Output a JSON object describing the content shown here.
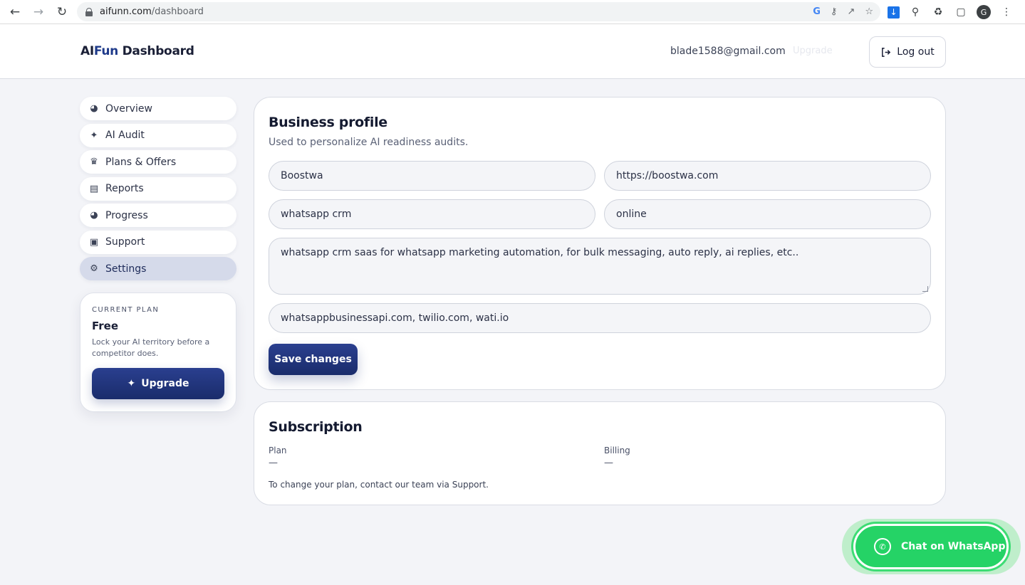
{
  "browser": {
    "url_host": "aifunn.com",
    "url_path": "/dashboard",
    "profile_initial": "G"
  },
  "header": {
    "brand_prefix": "AI",
    "brand_accent": "Fun",
    "brand_suffix": " Dashboard",
    "email": "blade1588@gmail.com",
    "ghost_upgrade": "Upgrade",
    "logout_label": "Log out"
  },
  "sidebar": {
    "items": [
      {
        "label": "Overview",
        "icon": "gauge-icon"
      },
      {
        "label": "AI Audit",
        "icon": "sparkles-icon"
      },
      {
        "label": "Plans & Offers",
        "icon": "crown-icon"
      },
      {
        "label": "Reports",
        "icon": "document-icon"
      },
      {
        "label": "Progress",
        "icon": "gauge-icon"
      },
      {
        "label": "Support",
        "icon": "chat-icon"
      },
      {
        "label": "Settings",
        "icon": "gear-icon"
      }
    ],
    "active_item": "Settings"
  },
  "plan_card": {
    "kicker": "CURRENT PLAN",
    "name": "Free",
    "description": "Lock your AI territory before a competitor does.",
    "upgrade_label": "Upgrade"
  },
  "business_profile": {
    "title": "Business profile",
    "subtitle": "Used to personalize AI readiness audits.",
    "business_name": "Boostwa",
    "website": "https://boostwa.com",
    "industry": "whatsapp crm",
    "location": "online",
    "description": "whatsapp crm saas for whatsapp marketing automation, for bulk messaging, auto reply, ai replies, etc..",
    "competitors": "whatsappbusinessapi.com, twilio.com, wati.io",
    "save_label": "Save changes"
  },
  "subscription": {
    "title": "Subscription",
    "plan_label": "Plan",
    "plan_value": "—",
    "billing_label": "Billing",
    "billing_value": "—",
    "note": "To change your plan, contact our team via Support."
  },
  "whatsapp": {
    "label": "Chat on WhatsApp",
    "color": "#25d366"
  },
  "colors": {
    "primary": "#1e3a8a",
    "active_nav": "#d5daea",
    "background": "#f3f4f8"
  }
}
